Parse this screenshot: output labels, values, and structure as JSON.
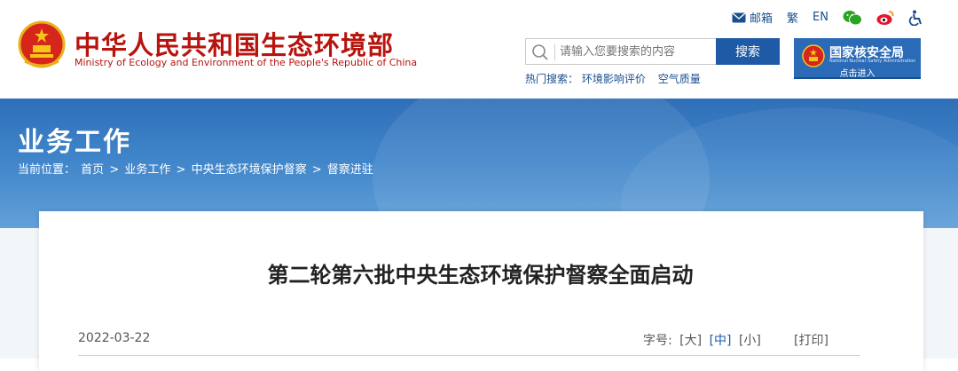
{
  "site": {
    "title": "中华人民共和国生态环境部",
    "subtitle": "Ministry of Ecology and Environment of the People's Republic of China"
  },
  "toplinks": {
    "mail": "邮箱",
    "traditional": "繁",
    "english": "EN"
  },
  "search": {
    "placeholder": "请输入您要搜索的内容",
    "button": "搜索",
    "hot_label": "热门搜索：",
    "hot_items": [
      "环境影响评价",
      "空气质量"
    ]
  },
  "nnsa": {
    "title": "国家核安全局",
    "english": "National Nuclear Safety Administration",
    "enter": "点击进入"
  },
  "banner": {
    "title": "业务工作",
    "crumb_label": "当前位置：",
    "crumbs": [
      "首页",
      "业务工作",
      "中央生态环境保护督察",
      "督察进驻"
    ],
    "sep": ">"
  },
  "article": {
    "title": "第二轮第六批中央生态环境保护督察全面启动",
    "date": "2022-03-22",
    "font_label": "字号:",
    "font_large": "[大]",
    "font_medium": "[中]",
    "font_small": "[小]",
    "print": "[打印]"
  },
  "colors": {
    "brand_red": "#b8140e",
    "link_blue": "#1a4f8f",
    "button_blue": "#1e5aa6"
  }
}
